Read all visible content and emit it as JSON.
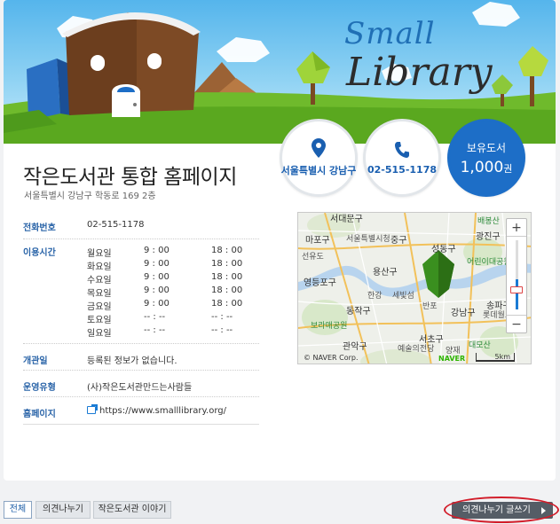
{
  "brand": {
    "small": "Small",
    "library": "Library"
  },
  "library": {
    "name": "작은도서관 통합 홈페이지",
    "address": "서울특별시 강남구 학동로 169 2층"
  },
  "circles": {
    "location": {
      "icon": "map-pin-icon",
      "label": "서울특별시 강남구"
    },
    "phone": {
      "icon": "phone-icon",
      "label": "02-515-1178"
    },
    "books": {
      "title": "보유도서",
      "value": "1,000",
      "unit": "권"
    }
  },
  "info": {
    "phone_label": "전화번호",
    "phone_value": "02-515-1178",
    "hours_label": "이용시간",
    "hours": [
      {
        "day": "월요일",
        "open": "9 : 00",
        "close": "18 : 00"
      },
      {
        "day": "화요일",
        "open": "9 : 00",
        "close": "18 : 00"
      },
      {
        "day": "수요일",
        "open": "9 : 00",
        "close": "18 : 00"
      },
      {
        "day": "목요일",
        "open": "9 : 00",
        "close": "18 : 00"
      },
      {
        "day": "금요일",
        "open": "9 : 00",
        "close": "18 : 00"
      },
      {
        "day": "토요일",
        "open": "-- : --",
        "close": "-- : --"
      },
      {
        "day": "일요일",
        "open": "-- : --",
        "close": "-- : --"
      }
    ],
    "opened_label": "개관일",
    "opened_value": "등록된 정보가 없습니다.",
    "type_label": "운영유형",
    "type_value": "(사)작은도서관만드는사람들",
    "homepage_label": "홈페이지",
    "homepage_value": "https://www.smalllibrary.org/"
  },
  "map": {
    "labels": [
      "서대문구",
      "마포구",
      "서울특별시청",
      "중구",
      "성동구",
      "광진구",
      "배봉산",
      "어린이대공원",
      "선유도",
      "영등포구",
      "용산구",
      "한강",
      "세빛섬",
      "동작구",
      "반포",
      "강남구",
      "송파구",
      "롯데월드",
      "보라매공원",
      "관악구",
      "서초구",
      "예술의전당",
      "양재",
      "대모산"
    ],
    "copyright": "© NAVER Corp.",
    "logo": "NAVER",
    "scale": "5km",
    "zoom_in": "+",
    "zoom_out": "−"
  },
  "tabs": [
    {
      "label": "전체"
    },
    {
      "label": "의견나누기"
    },
    {
      "label": "작은도서관 이야기"
    }
  ],
  "write_button": "의견나누기 글쓰기",
  "colors": {
    "accent": "#1d6ec7",
    "label": "#2a64a8",
    "highlight": "#d21d2a"
  }
}
